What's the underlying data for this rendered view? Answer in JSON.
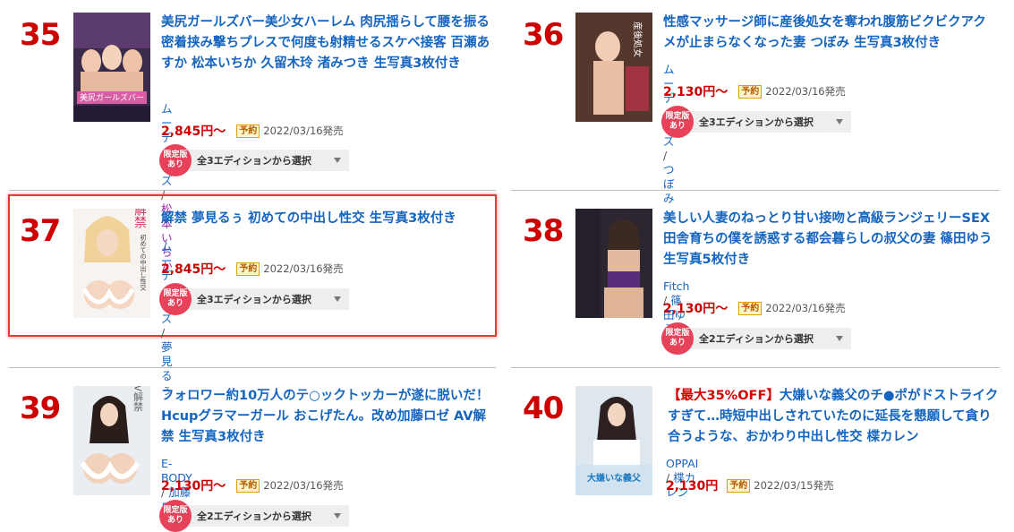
{
  "items": [
    {
      "rank": "35",
      "title": "美尻ガールズバー美少女ハーレム 肉尻揺らして腰を振る密着挟み撃ちプレスで何度も射精せるスケベ接客 百瀬あすか 松本いちか 久留木玲 渚みつき 生写真3枚付き",
      "maker": "ムーディーズ",
      "actress": "松本いちか",
      "price": "2,845円〜",
      "badge": "予約",
      "date": "2022/03/16発売",
      "limited": [
        "限定版",
        "あり"
      ],
      "edition": "全3エディションから選択"
    },
    {
      "rank": "36",
      "title": "性感マッサージ師に産後処女を奪われ腹筋ビクビクアクメが止まらなくなった妻 つぼみ 生写真3枚付き",
      "maker": "ムーディーズ",
      "actress": "つぼみ",
      "price": "2,130円〜",
      "badge": "予約",
      "date": "2022/03/16発売",
      "limited": [
        "限定版",
        "あり"
      ],
      "edition": "全3エディションから選択"
    },
    {
      "rank": "37",
      "title": "解禁 夢見るぅ 初めての中出し性交 生写真3枚付き",
      "maker": "ムーディーズ",
      "actress": "夢見るぅ",
      "price": "2,845円〜",
      "badge": "予約",
      "date": "2022/03/16発売",
      "limited": [
        "限定版",
        "あり"
      ],
      "edition": "全3エディションから選択"
    },
    {
      "rank": "38",
      "title": "美しい人妻のねっとり甘い接吻と高級ランジェリーSEX 田舎育ちの僕を誘惑する都会暮らしの叔父の妻 篠田ゆう 生写真5枚付き",
      "maker": "Fitch",
      "actress": "篠田ゆう",
      "price": "2,130円〜",
      "badge": "予約",
      "date": "2022/03/16発売",
      "limited": [
        "限定版",
        "あり"
      ],
      "edition": "全2エディションから選択"
    },
    {
      "rank": "39",
      "title": "フォロワー約10万人のテ○ックトッカーが遂に脱いだ！ Hcupグラマーガール おこげたん。改め加藤ロゼ AV解禁 生写真3枚付き",
      "maker": "E-BODY",
      "actress": "加藤ロゼ",
      "price": "2,130円〜",
      "badge": "予約",
      "date": "2022/03/16発売",
      "limited": [
        "限定版",
        "あり"
      ],
      "edition": "全2エディションから選択"
    },
    {
      "rank": "40",
      "promo": "【最大35%OFF】",
      "title": "大嫌いな義父のチ●ポがドストライクすぎて…時短中出しされていたのに延長を懇願して貪り合うような、おかわり中出し性交 楪カレン",
      "maker": "OPPAI",
      "actress": "楪カレン",
      "price": "2,130円",
      "badge": "予約",
      "date": "2022/03/15発売"
    }
  ],
  "separator": "/",
  "cover_text": {
    "i35": "美尻ガールズバー",
    "i36": "産後処女",
    "i37": "解禁",
    "i37b": "初めての中出し性交",
    "i37c": "夢見るぅ",
    "i39": "AV解禁",
    "i40": "大嫌いな義父"
  },
  "colors": {
    "rank": "#cc0000",
    "title_link": "#1565c0",
    "price": "#cc0000",
    "limited_badge": "#e8425a",
    "highlight_border": "#e53935"
  }
}
